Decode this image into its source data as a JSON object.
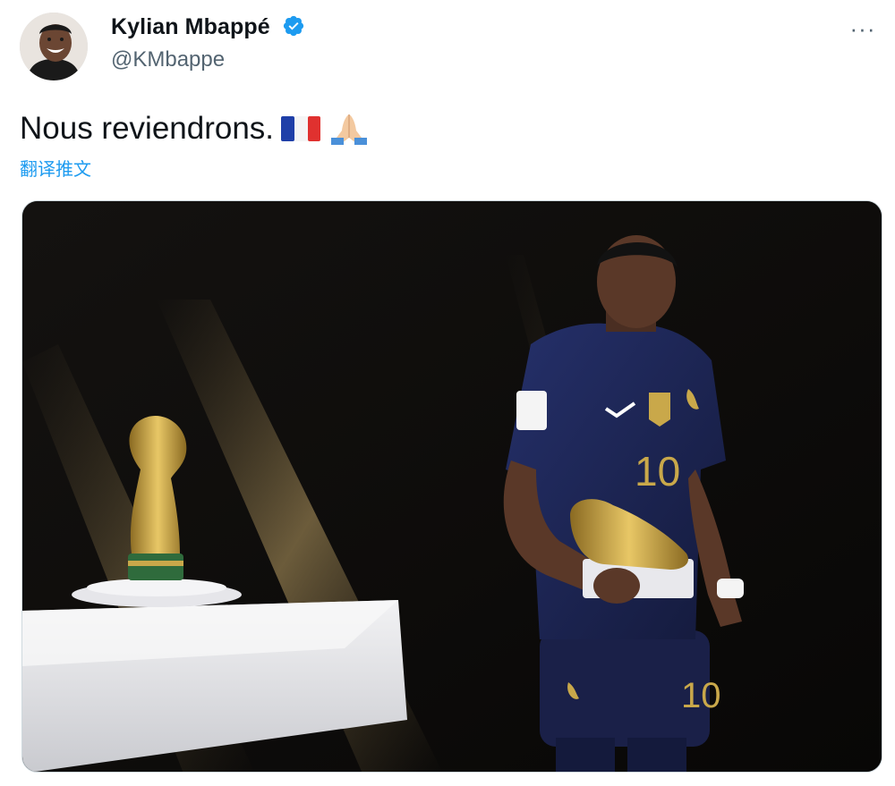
{
  "author": {
    "display_name": "Kylian Mbappé",
    "handle": "@KMbappe",
    "verified": true,
    "avatar_icon": "profile-photo"
  },
  "tweet": {
    "text": "Nous reviendrons.",
    "emojis": [
      "flag-france-icon",
      "folded-hands-icon"
    ],
    "translate_label": "翻译推文"
  },
  "media": {
    "description_icon": "photo",
    "jersey_number": "10"
  },
  "menu": {
    "more_label": "···"
  },
  "colors": {
    "accent": "#1d9bf0",
    "secondary_text": "#536471",
    "jersey": "#1b2350",
    "gold": "#c9a84a"
  }
}
